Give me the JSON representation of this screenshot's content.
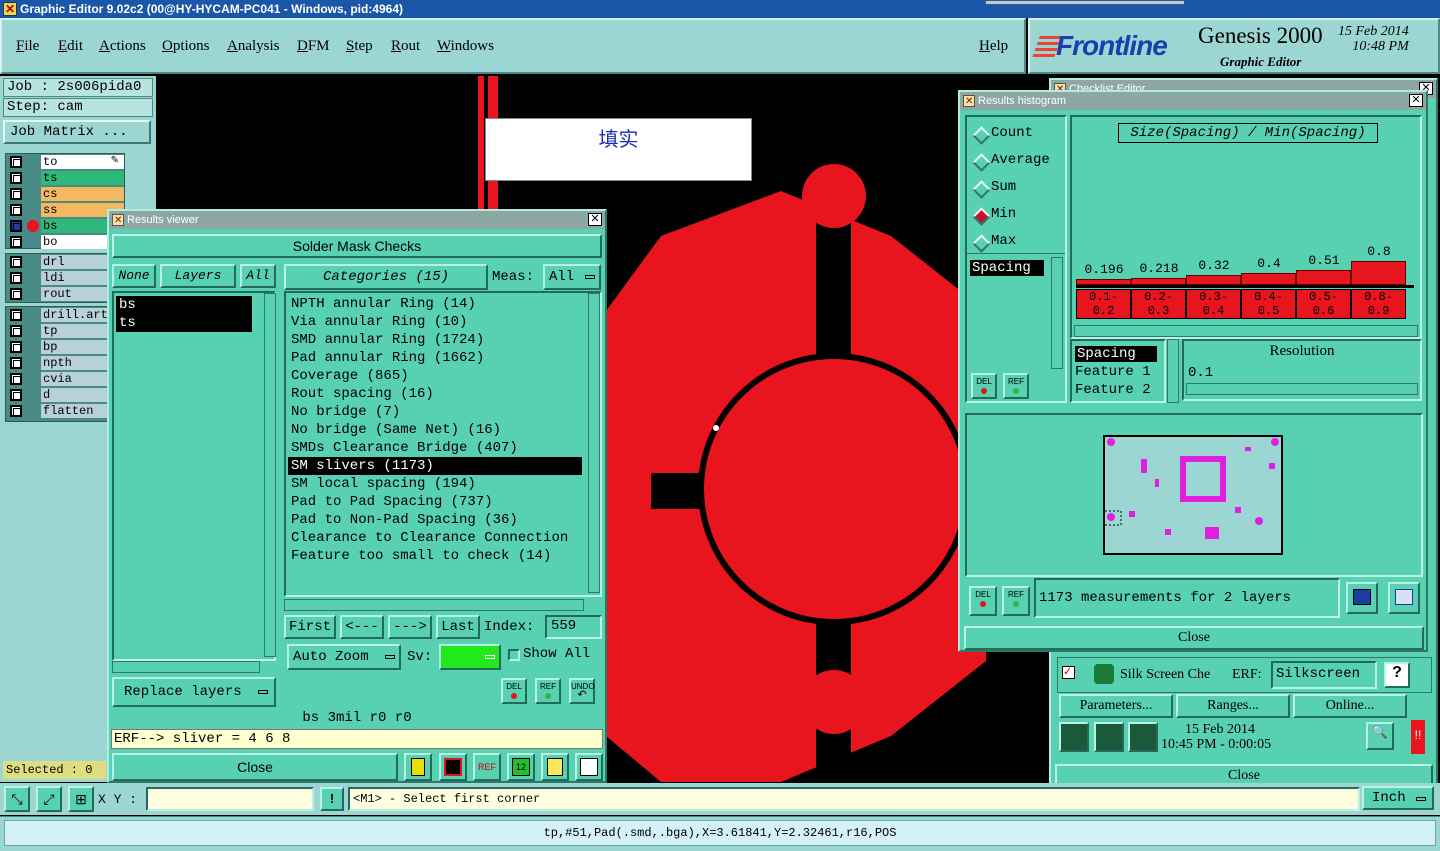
{
  "window_title": "Graphic Editor 9.02c2 (00@HY-HYCAM-PC041 - Windows, pid:4964)",
  "menu": [
    "File",
    "Edit",
    "Actions",
    "Options",
    "Analysis",
    "DFM",
    "Step",
    "Rout",
    "Windows"
  ],
  "help": "Help",
  "brand": {
    "logo": "Frontline",
    "product": "Genesis 2000",
    "subtitle": "Graphic Editor",
    "date": "15 Feb 2014",
    "time": "10:48 PM"
  },
  "job": {
    "job_label": "Job : 2s006pida0",
    "step_label": "Step: cam",
    "matrix_button": "Job Matrix ..."
  },
  "layers_top": [
    {
      "name": "to",
      "color": "#ffffff"
    },
    {
      "name": "ts",
      "color": "#2eb87a"
    },
    {
      "name": "cs",
      "color": "#f4b860"
    },
    {
      "name": "ss",
      "color": "#f4b860"
    },
    {
      "name": "bs",
      "color": "#2eb87a"
    },
    {
      "name": "bo",
      "color": "#ffffff"
    }
  ],
  "layers_mid": [
    "drl",
    "ldi",
    "rout"
  ],
  "layers_bottom": [
    "drill.art",
    "tp",
    "bp",
    "npth",
    "cvia",
    "d",
    "flatten"
  ],
  "selected_status": "Selected : 0",
  "canvas_label": "填实",
  "results_viewer": {
    "title": "Results viewer",
    "header": "Solder Mask Checks",
    "none_btn": "None",
    "layers_btn": "Layers",
    "all_btn": "All",
    "categories_btn": "Categories (15)",
    "meas_label": "Meas:",
    "meas_value": "All",
    "layers": [
      "bs",
      "ts"
    ],
    "categories": [
      "NPTH annular Ring (14)",
      "Via annular Ring (10)",
      "SMD annular Ring (1724)",
      "Pad annular Ring (1662)",
      "Coverage (865)",
      "Rout spacing (16)",
      "No bridge (7)",
      "No bridge (Same Net) (16)",
      "SMDs Clearance Bridge (407)",
      "SM slivers (1173)",
      "SM local spacing (194)",
      "Pad to Pad Spacing (737)",
      "Pad to Non-Pad Spacing (36)",
      "Clearance to Clearance Connection",
      "Feature too small to check (14)"
    ],
    "selected_category_index": 9,
    "first_btn": "First",
    "prev_btn": "<---",
    "next_btn": "--->",
    "last_btn": "Last",
    "index_label": "Index:",
    "index_value": "559",
    "auto_zoom": "Auto Zoom",
    "sv_label": "Sv:",
    "show_all": "Show All",
    "replace_layers": "Replace layers",
    "info_line": "bs 3mil  r0  r0",
    "erf_line": "ERF--> sliver = 4 6 8",
    "close": "Close",
    "del": "DEL",
    "ref": "REF",
    "undo": "UNDO"
  },
  "histogram": {
    "title": "Results histogram",
    "modes": [
      "Count",
      "Average",
      "Sum",
      "Min",
      "Max"
    ],
    "selected_mode": "Min",
    "list_item": "Spacing",
    "chart_title": "Size(Spacing) / Min(Spacing)",
    "bars": [
      {
        "label": "0.1-\n0.2",
        "value": 0.196,
        "value_text": "0.196"
      },
      {
        "label": "0.2-\n0.3",
        "value": 0.218,
        "value_text": "0.218"
      },
      {
        "label": "0.3-\n0.4",
        "value": 0.32,
        "value_text": "0.32"
      },
      {
        "label": "0.4-\n0.5",
        "value": 0.4,
        "value_text": "0.4"
      },
      {
        "label": "0.5-\n0.6",
        "value": 0.51,
        "value_text": "0.51"
      },
      {
        "label": "0.8-\n0.9",
        "value": 0.8,
        "value_text": "0.8"
      }
    ],
    "attrs": [
      "Spacing",
      "Feature 1",
      "Feature 2"
    ],
    "resolution_label": "Resolution",
    "resolution_value": "0.1",
    "measurements": "1173 measurements for 2 layers",
    "close": "Close",
    "del": "DEL",
    "ref": "REF"
  },
  "checklist_partial": {
    "title": "Checklist Editor",
    "row_label": "Silk Screen Che",
    "erf_label": "ERF:",
    "erf_value": "Silkscreen",
    "help": "?",
    "parameters": "Parameters...",
    "ranges": "Ranges...",
    "online": "Online...",
    "date": "15 Feb 2014",
    "time": "10:45 PM - 0:00:05",
    "close": "Close"
  },
  "bottom": {
    "xy_label": "X Y :",
    "xy_value": "",
    "bang": "!",
    "prompt": "<M1> - Select first corner",
    "units": "Inch"
  },
  "status_line": "tp,#51,Pad(.smd,.bga),X=3.61841,Y=2.32461,r16,POS"
}
